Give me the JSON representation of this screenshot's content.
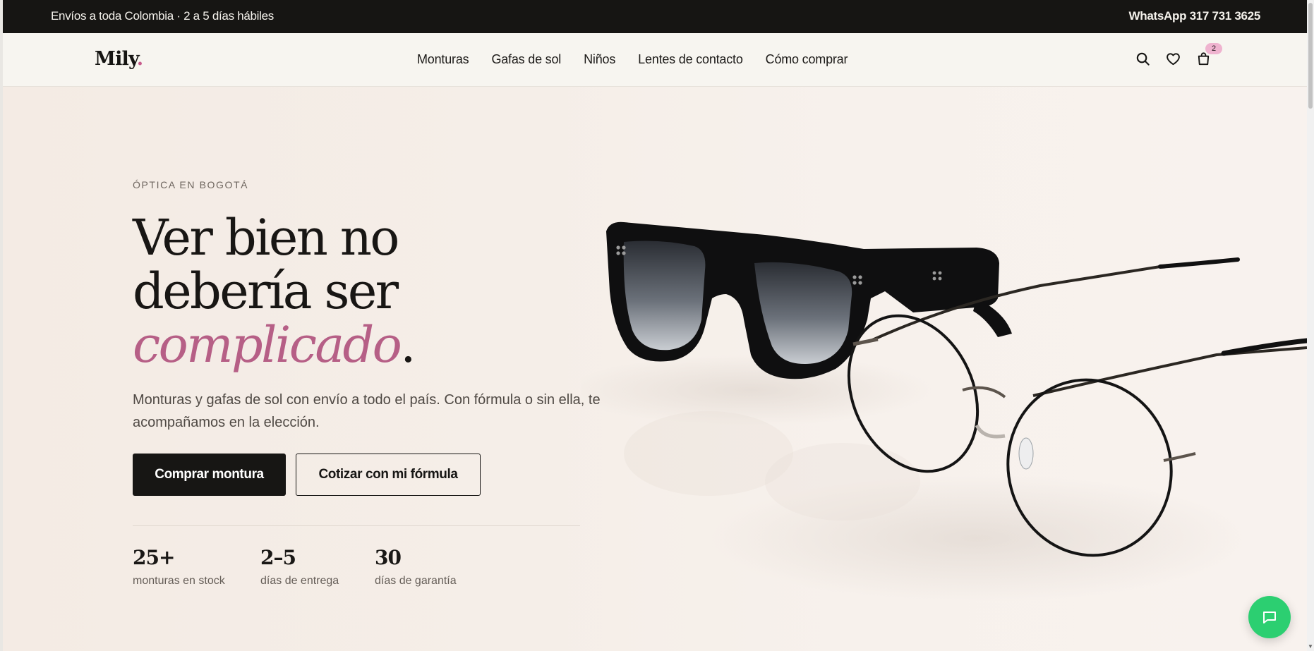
{
  "announcement": {
    "shipping": "Envíos a toda Colombia · 2 a 5 días hábiles",
    "whatsapp": "WhatsApp 317 731 3625"
  },
  "header": {
    "logo_text": "Mily",
    "logo_dot": ".",
    "nav": [
      {
        "label": "Monturas"
      },
      {
        "label": "Gafas de sol"
      },
      {
        "label": "Niños"
      },
      {
        "label": "Lentes de contacto"
      },
      {
        "label": "Cómo comprar"
      }
    ],
    "icons": [
      "search-icon",
      "heart-icon",
      "bag-icon"
    ],
    "cart_count": "2"
  },
  "hero": {
    "eyebrow": "ÓPTICA EN BOGOTÁ",
    "headline_line1": "Ver bien no",
    "headline_line2": "debería ser",
    "headline_accent": "complicado",
    "headline_end": ".",
    "subtitle": "Monturas y gafas de sol con envío a todo el país. Con fórmula o sin ella, te acompañamos en la elección.",
    "cta_primary": "Comprar montura",
    "cta_secondary": "Cotizar con mi fórmula",
    "stats": [
      {
        "value": "25+",
        "label": "monturas en stock"
      },
      {
        "value": "2–5",
        "label": "días de entrega"
      },
      {
        "value": "30",
        "label": "días de garantía"
      }
    ]
  },
  "colors": {
    "dark": "#161513",
    "accent_pink": "#b65f86",
    "chat_green": "#2ccf71",
    "background": "#f7f4ef"
  }
}
